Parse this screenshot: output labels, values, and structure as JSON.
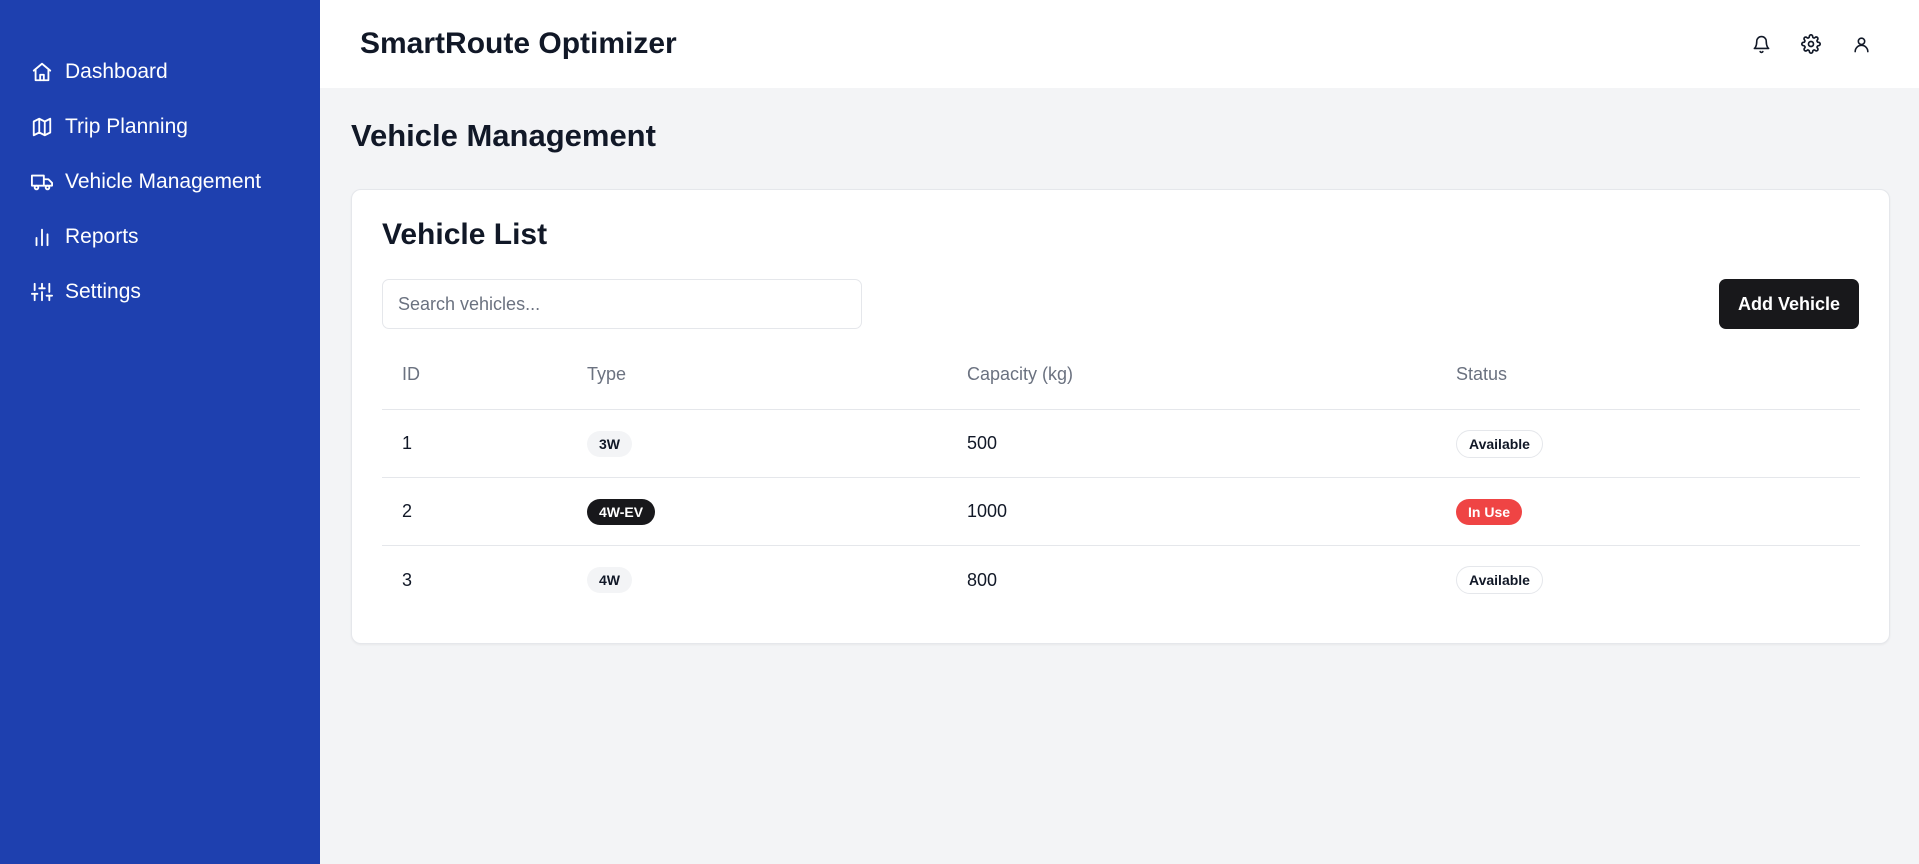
{
  "app": {
    "title": "SmartRoute Optimizer"
  },
  "sidebar": {
    "items": [
      {
        "label": "Dashboard",
        "icon": "home-icon"
      },
      {
        "label": "Trip Planning",
        "icon": "map-icon"
      },
      {
        "label": "Vehicle Management",
        "icon": "truck-icon"
      },
      {
        "label": "Reports",
        "icon": "bar-chart-icon"
      },
      {
        "label": "Settings",
        "icon": "sliders-icon"
      }
    ]
  },
  "header": {
    "icons": [
      "bell-icon",
      "gear-icon",
      "user-icon"
    ]
  },
  "page": {
    "title": "Vehicle Management"
  },
  "card": {
    "title": "Vehicle List",
    "search_placeholder": "Search vehicles...",
    "add_label": "Add Vehicle"
  },
  "table": {
    "columns": [
      "ID",
      "Type",
      "Capacity (kg)",
      "Status"
    ],
    "rows": [
      {
        "id": "1",
        "type": "3W",
        "type_style": "secondary",
        "capacity": "500",
        "status": "Available",
        "status_style": "outline"
      },
      {
        "id": "2",
        "type": "4W-EV",
        "type_style": "dark",
        "capacity": "1000",
        "status": "In Use",
        "status_style": "danger"
      },
      {
        "id": "3",
        "type": "4W",
        "type_style": "secondary",
        "capacity": "800",
        "status": "Available",
        "status_style": "outline"
      }
    ]
  },
  "colors": {
    "sidebar_bg": "#1e40af",
    "page_bg": "#f3f4f6",
    "primary_button": "#18181b",
    "danger": "#ef4444"
  }
}
